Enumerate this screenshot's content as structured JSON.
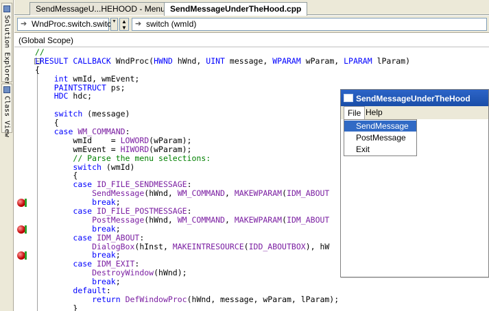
{
  "side_panel": {
    "tabs": [
      {
        "label": "Solution Explorer",
        "icon": "solution-explorer-icon"
      },
      {
        "label": "Class View",
        "icon": "class-view-icon"
      }
    ]
  },
  "tabs": [
    {
      "label": "SendMessageU...HEHOOD - Menu",
      "active": false
    },
    {
      "label": "SendMessageUnderTheHood.cpp",
      "active": true
    }
  ],
  "nav": {
    "left_combo": "WndProc.switch.switch",
    "right_combo": "switch (wmId)"
  },
  "scope": "(Global Scope)",
  "code_lines": [
    "//",
    "LRESULT CALLBACK WndProc(HWND hWnd, UINT message, WPARAM wParam, LPARAM lParam)",
    "{",
    "    int wmId, wmEvent;",
    "    PAINTSTRUCT ps;",
    "    HDC hdc;",
    "",
    "    switch (message)",
    "    {",
    "    case WM_COMMAND:",
    "        wmId    = LOWORD(wParam);",
    "        wmEvent = HIWORD(wParam);",
    "        // Parse the menu selections:",
    "        switch (wmId)",
    "        {",
    "        case ID_FILE_SENDMESSAGE:",
    "            SendMessage(hWnd, WM_COMMAND, MAKEWPARAM(IDM_ABOUT",
    "            break;",
    "        case ID_FILE_POSTMESSAGE:",
    "            PostMessage(hWnd, WM_COMMAND, MAKEWPARAM(IDM_ABOUT",
    "            break;",
    "        case IDM_ABOUT:",
    "            DialogBox(hInst, MAKEINTRESOURCE(IDD_ABOUTBOX), hW",
    "            break;",
    "        case IDM_EXIT:",
    "            DestroyWindow(hWnd);",
    "            break;",
    "        default:",
    "            return DefWindowProc(hWnd, message, wParam, lParam);",
    "        }"
  ],
  "breakpoint_lines": [
    17,
    20,
    23
  ],
  "app_window": {
    "title": "SendMessageUnderTheHood",
    "menus": [
      "File",
      "Help"
    ],
    "file_menu_items": [
      "SendMessage",
      "PostMessage",
      "Exit"
    ],
    "selected_item": "SendMessage"
  },
  "colors": {
    "keyword": "#0000ff",
    "macro": "#7b1fa2",
    "comment": "#008000",
    "breakpoint": "#c00000",
    "titlebar": "#2c64c8",
    "menu_highlight": "#316ac5"
  }
}
